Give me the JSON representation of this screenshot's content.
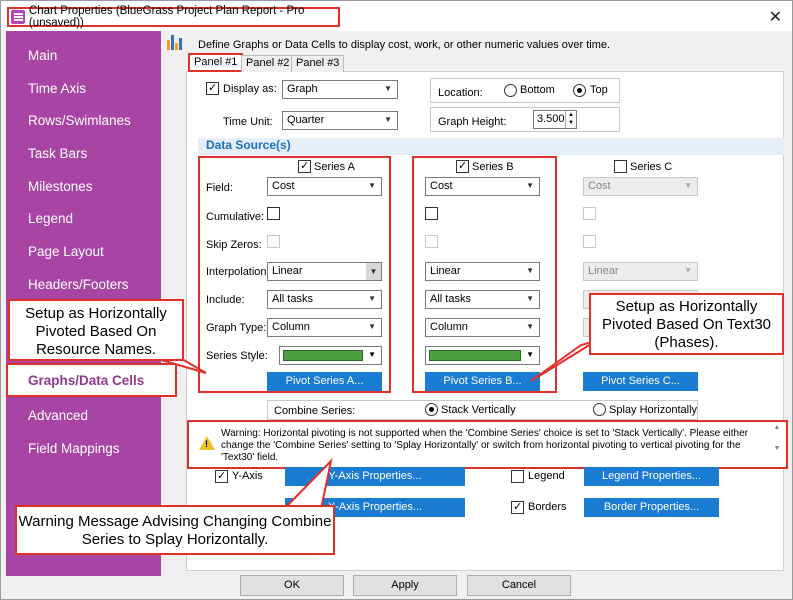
{
  "window": {
    "title": "Chart Properties (BlueGrass Project Plan Report - Pro (unsaved))",
    "close": "✕"
  },
  "sidebar": {
    "items": [
      "Main",
      "Time Axis",
      "Rows/Swimlanes",
      "Task Bars",
      "Milestones",
      "Legend",
      "Page Layout",
      "Headers/Footers",
      "Graphs/Data Cells",
      "Advanced",
      "Field Mappings"
    ],
    "active": "Graphs/Data Cells"
  },
  "main": {
    "description": "Define Graphs or Data Cells to display cost, work, or other numeric values over time.",
    "tabs": [
      "Panel #1",
      "Panel #2",
      "Panel #3"
    ],
    "display_as_label": "Display as:",
    "display_as_value": "Graph",
    "location_label": "Location:",
    "location_bottom": "Bottom",
    "location_top": "Top",
    "time_unit_label": "Time Unit:",
    "time_unit_value": "Quarter",
    "graph_height_label": "Graph Height:",
    "graph_height_value": "3.500",
    "data_sources_title": "Data Source(s)"
  },
  "row_labels": {
    "field": "Field:",
    "cumulative": "Cumulative:",
    "skip_zeros": "Skip Zeros:",
    "interpolation": "Interpolation:",
    "include": "Include:",
    "graph_type": "Graph Type:",
    "series_style": "Series Style:"
  },
  "series": [
    {
      "name": "Series A",
      "field": "Cost",
      "interpolation": "Linear",
      "include": "All tasks",
      "graph_type": "Column",
      "pivot": "Pivot Series A..."
    },
    {
      "name": "Series B",
      "field": "Cost",
      "interpolation": "Linear",
      "include": "All tasks",
      "graph_type": "Column",
      "pivot": "Pivot Series B..."
    },
    {
      "name": "Series C",
      "field": "Cost",
      "interpolation": "Linear",
      "pivot": "Pivot Series C..."
    }
  ],
  "combine": {
    "label": "Combine Series:",
    "stack": "Stack Vertically",
    "splay": "Splay Horizontally"
  },
  "warning": {
    "text": "Warning: Horizontal pivoting is not supported when the 'Combine Series' choice is set to 'Stack Vertically'.  Please either change the 'Combine Series' setting to 'Splay Horizontally' or switch from horizontal pivoting to vertical pivoting for the 'Text30' field."
  },
  "options": {
    "y_axis": "Y-Axis",
    "y_axis_btn": "Y-Axis Properties...",
    "legend": "Legend",
    "legend_btn": "Legend Properties...",
    "borders": "Borders",
    "border_btn": "Border Properties...",
    "x_btn": "X-Axis Properties..."
  },
  "callouts": {
    "left": "Setup  as Horizontally Pivoted Based On Resource Names.",
    "right": "Setup  as Horizontally Pivoted Based On Text30 (Phases).",
    "bottom": "Warning Message Advising Changing Combine Series to Splay Horizontally."
  },
  "buttons": {
    "ok": "OK",
    "apply": "Apply",
    "cancel": "Cancel"
  },
  "colors": {
    "sidebar": "#a844a3",
    "accent": "#1a7bd3",
    "callout_border": "#e0302a",
    "series_fill": "#4da040"
  }
}
